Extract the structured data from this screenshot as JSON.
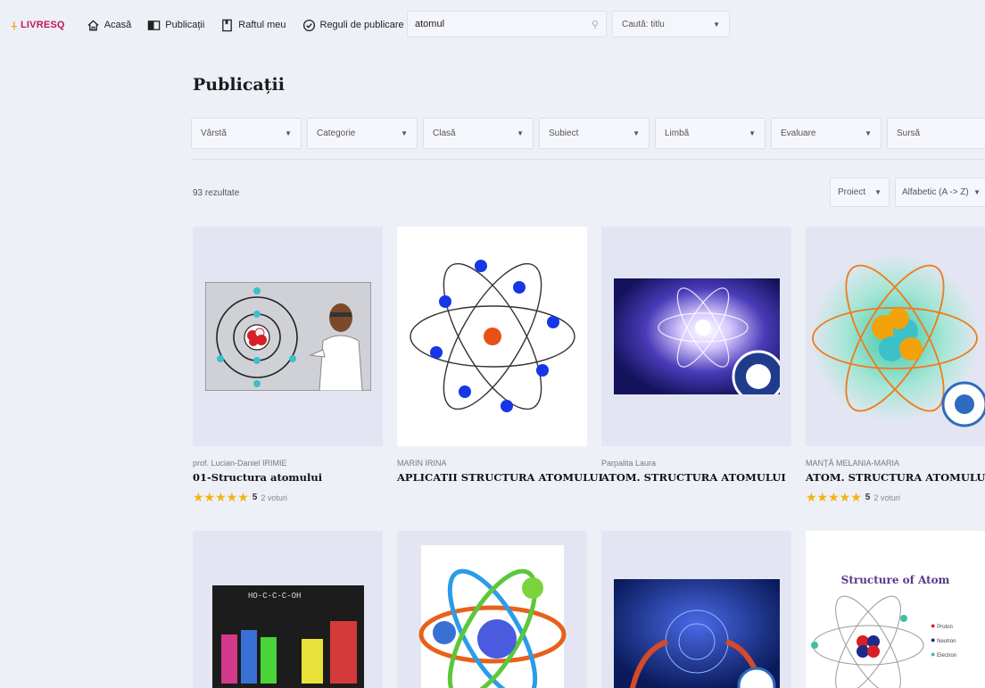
{
  "nav": {
    "logo": "LIVRESQ",
    "items": [
      {
        "label": "Acasă",
        "icon": "home-icon"
      },
      {
        "label": "Publicații",
        "icon": "book-icon"
      },
      {
        "label": "Raftul meu",
        "icon": "bookmark-icon"
      },
      {
        "label": "Reguli de publicare",
        "icon": "check-circle-icon"
      }
    ],
    "search_value": "atomul",
    "search_type": "Caută: titlu"
  },
  "page": {
    "title": "Publicații",
    "results": "93 rezultate",
    "filters": [
      "Vârstă",
      "Categorie",
      "Clasă",
      "Subiect",
      "Limbă",
      "Evaluare",
      "Sursă"
    ],
    "sort_type": "Proiect",
    "sort_order": "Alfabetic (A -> Z)"
  },
  "cards": [
    {
      "author": "prof. Lucian-Daniel IRIMIE",
      "title": "01-Structura atomului",
      "stars": "★★★★★",
      "score": "5",
      "votes": "2 voturi"
    },
    {
      "author": "MARIN IRINA",
      "title": "APLICATII STRUCTURA ATOMULUI",
      "stars": "",
      "score": "",
      "votes": ""
    },
    {
      "author": "Parpalita Laura",
      "title": "ATOM. STRUCTURA ATOMULUI",
      "stars": "",
      "score": "",
      "votes": ""
    },
    {
      "author": "MANȚĂ MELANIA-MARIA",
      "title": "ATOM. STRUCTURA ATOMULUI",
      "stars": "★★★★★",
      "score": "5",
      "votes": "2 voturi"
    }
  ],
  "second_row": {
    "structure_title": "Structure of Atom",
    "legend": [
      "Proton",
      "Neutron",
      "Electron"
    ]
  },
  "colors": {
    "brand": "#c2185b",
    "star": "#f2b30a",
    "background": "#eef0f8"
  }
}
